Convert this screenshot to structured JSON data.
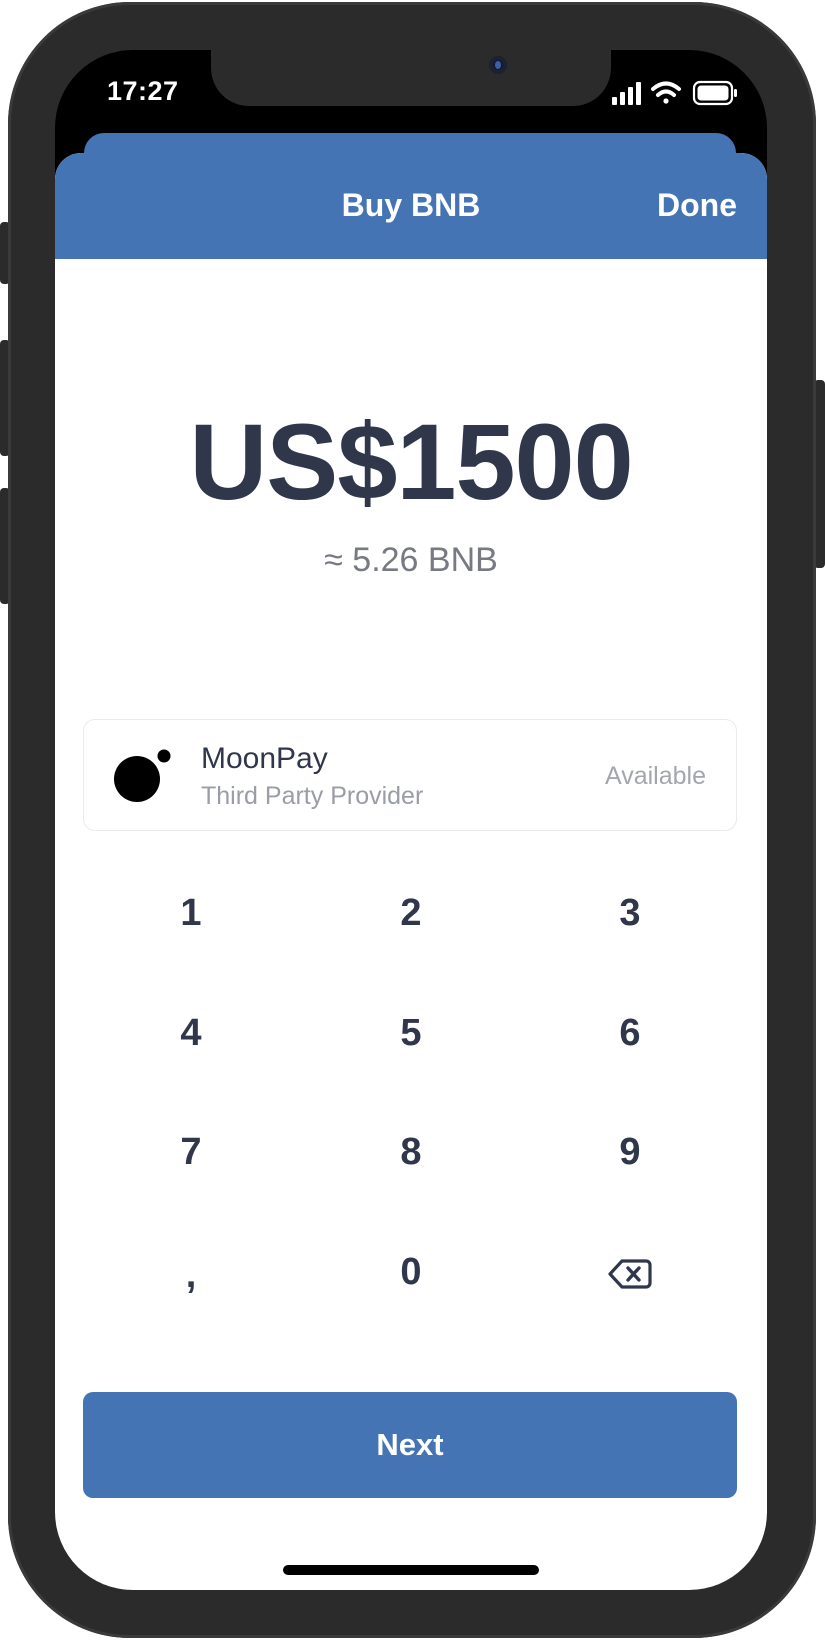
{
  "status_bar": {
    "time": "17:27",
    "icons": [
      "signal-icon",
      "wifi-icon",
      "battery-icon"
    ]
  },
  "sheet": {
    "title": "Buy BNB",
    "done_label": "Done",
    "header_color": "#4574b5"
  },
  "amount": {
    "fiat": "US$1500",
    "crypto_estimate": "≈ 5.26 BNB"
  },
  "provider": {
    "name": "MoonPay",
    "subtitle": "Third Party Provider",
    "status": "Available",
    "logo_icon": "moonpay-logo-icon"
  },
  "keypad": {
    "keys": [
      "1",
      "2",
      "3",
      "4",
      "5",
      "6",
      "7",
      "8",
      "9",
      ",",
      "0"
    ],
    "backspace_icon": "backspace-icon"
  },
  "next_button": {
    "label": "Next",
    "color": "#4574b5"
  }
}
